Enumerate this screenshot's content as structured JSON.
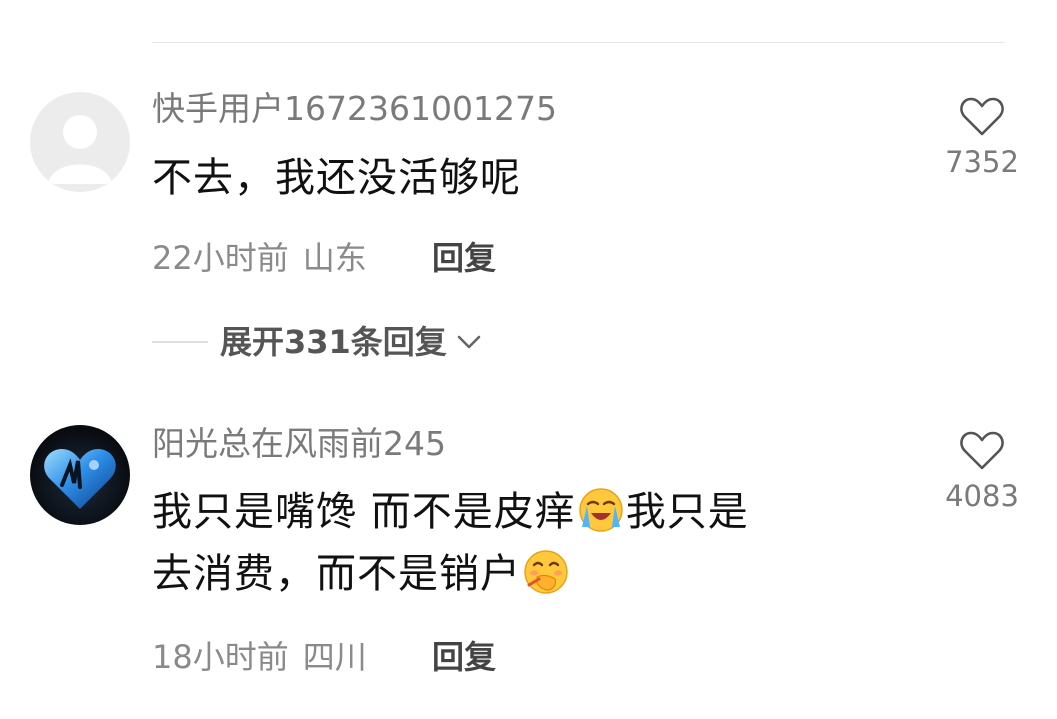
{
  "comments": [
    {
      "username": "快手用户1672361001275",
      "content_lines": [
        "不去，我还没活够呢"
      ],
      "time": "22小时前",
      "location": "山东",
      "reply_label": "回复",
      "likes": "7352",
      "avatar": "default-avatar"
    },
    {
      "username": "阳光总在风雨前245",
      "content_lines": [
        {
          "a": "我只是嘴馋 而不是皮痒",
          "emoji": "loudly-crying-face-emoji",
          "b": "我只是"
        },
        {
          "a": "去消费，而不是销户",
          "emoji": "face-with-hand-over-mouth-emoji"
        }
      ],
      "time": "18小时前",
      "location": "四川",
      "reply_label": "回复",
      "likes": "4083",
      "avatar": "blue-heart-avatar"
    }
  ],
  "expand_replies": {
    "label": "展开331条回复",
    "icon": "chevron-down-icon"
  },
  "colors": {
    "username": "#7a7a7a",
    "content": "#111111",
    "meta": "#8a8a8a",
    "reply": "#444444"
  }
}
